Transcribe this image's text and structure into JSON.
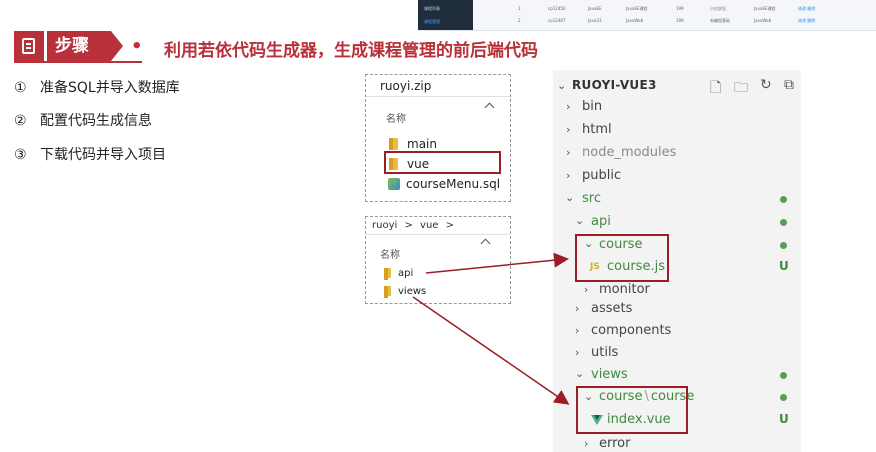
{
  "thumbnail": {
    "sidebar": [
      "课程列表",
      "课程管理"
    ],
    "rows": [
      {
        "id": "1",
        "code": "cp12450",
        "subject": "JavaEE",
        "name": "JavaEE课程",
        "price": "199",
        "target": "小白学员",
        "intro": "JavaEE课程",
        "actions": "修改 删除"
      },
      {
        "id": "2",
        "code": "cp12467",
        "subject": "Java23",
        "name": "JavaWeb",
        "price": "199",
        "target": "有编程基础",
        "intro": "JavaWeb",
        "actions": "修改 删除"
      }
    ]
  },
  "header": {
    "tag": "步骤",
    "bullet": "•",
    "title": "利用若依代码生成器，生成课程管理的前后端代码"
  },
  "steps": [
    {
      "num": "①",
      "text": "准备SQL并导入数据库"
    },
    {
      "num": "②",
      "text": "配置代码生成信息"
    },
    {
      "num": "③",
      "text": "下载代码并导入项目"
    }
  ],
  "zip_panel": {
    "path": "ruoyi.zip",
    "col_header": "名称",
    "items": [
      "main",
      "vue",
      "courseMenu.sql"
    ]
  },
  "vue_panel": {
    "path": [
      "ruoyi",
      "vue"
    ],
    "sep": ">",
    "col_header": "名称",
    "items": [
      "api",
      "views"
    ]
  },
  "explorer": {
    "title": "RUOYI-VUE3",
    "tree": {
      "bin": "bin",
      "html": "html",
      "node_modules": "node_modules",
      "public": "public",
      "src": "src",
      "api": "api",
      "course": "course",
      "course_js": "course.js",
      "monitor": "monitor",
      "assets": "assets",
      "components": "components",
      "utils": "utils",
      "views": "views",
      "course_course_a": "course",
      "course_course_sep": "\\",
      "course_course_b": "course",
      "index_vue": "index.vue",
      "error": "error"
    },
    "untracked_badge": "U",
    "js_icon": "JS",
    "colors": {
      "accent": "#b7303a",
      "git_green": "#3d8b3d",
      "arrow": "#9b1d26"
    }
  }
}
